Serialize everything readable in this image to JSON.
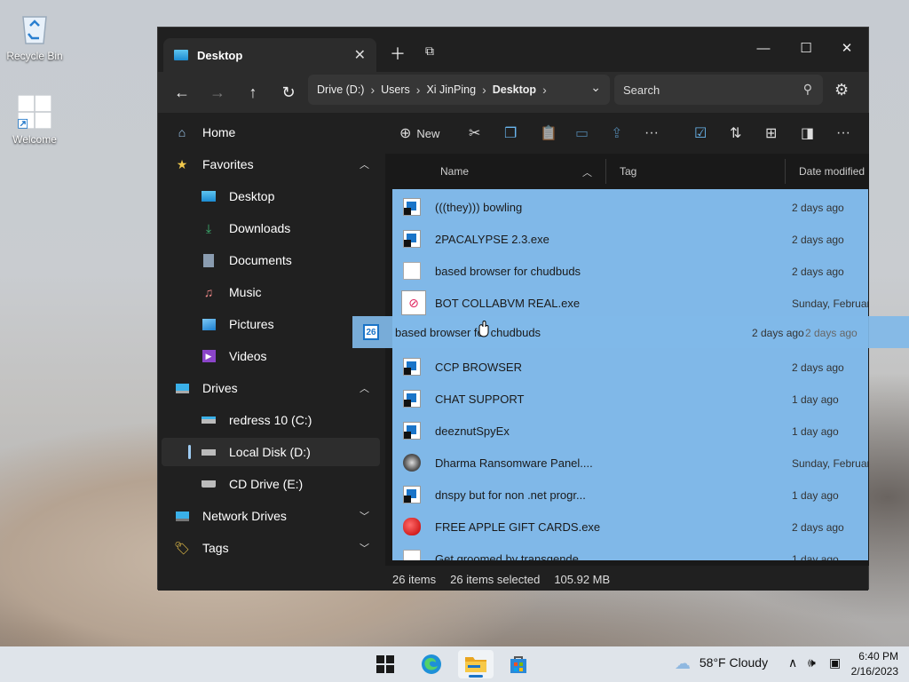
{
  "desktop": {
    "icons": [
      {
        "label": "Recycle Bin"
      },
      {
        "label": "Welcome"
      }
    ]
  },
  "window": {
    "tab_title": "Desktop",
    "address": {
      "crumbs": [
        "Drive (D:)",
        "Users",
        "Xi JinPing",
        "Desktop"
      ]
    },
    "search_placeholder": "Search"
  },
  "sidebar": {
    "items": [
      {
        "label": "Home"
      },
      {
        "label": "Favorites"
      },
      {
        "label": "Desktop"
      },
      {
        "label": "Downloads"
      },
      {
        "label": "Documents"
      },
      {
        "label": "Music"
      },
      {
        "label": "Pictures"
      },
      {
        "label": "Videos"
      },
      {
        "label": "Drives"
      },
      {
        "label": "redress 10 (C:)"
      },
      {
        "label": "Local Disk (D:)"
      },
      {
        "label": "CD Drive (E:)"
      },
      {
        "label": "Network Drives"
      },
      {
        "label": "Tags"
      }
    ]
  },
  "toolbar": {
    "new_label": "New",
    "more": "···"
  },
  "columns": {
    "name": "Name",
    "tag": "Tag",
    "date": "Date modified"
  },
  "files": [
    {
      "name": "(((they))) bowling",
      "date": "2 days ago"
    },
    {
      "name": "2PACALYPSE 2.3.exe",
      "date": "2 days ago"
    },
    {
      "name": "based browser for chudbuds",
      "date": "2 days ago"
    },
    {
      "name": "BOT COLLABVM REAL.exe",
      "date": "Sunday, Februar"
    },
    {
      "name": "",
      "date": ""
    },
    {
      "name": "CCP BROWSER",
      "date": "2 days ago"
    },
    {
      "name": "CHAT SUPPORT",
      "date": "1 day ago"
    },
    {
      "name": "deeznutSpyEx",
      "date": "1 day ago"
    },
    {
      "name": "Dharma Ransomware Panel....",
      "date": "Sunday, Februar"
    },
    {
      "name": "dnspy but for non .net progr...",
      "date": "1 day ago"
    },
    {
      "name": "FREE APPLE GIFT CARDS.exe",
      "date": "2 days ago"
    },
    {
      "name": "Get groomed by transgende...",
      "date": "1 day ago"
    }
  ],
  "drag": {
    "badge": "26",
    "name": "based browser for chudbuds",
    "date": "2 days ago",
    "date_under": "2 days ago"
  },
  "status": {
    "count": "26 items",
    "selected": "26 items selected",
    "size": "105.92 MB"
  },
  "taskbar": {
    "weather": "58°F  Cloudy",
    "time": "6:40 PM",
    "date": "2/16/2023"
  }
}
